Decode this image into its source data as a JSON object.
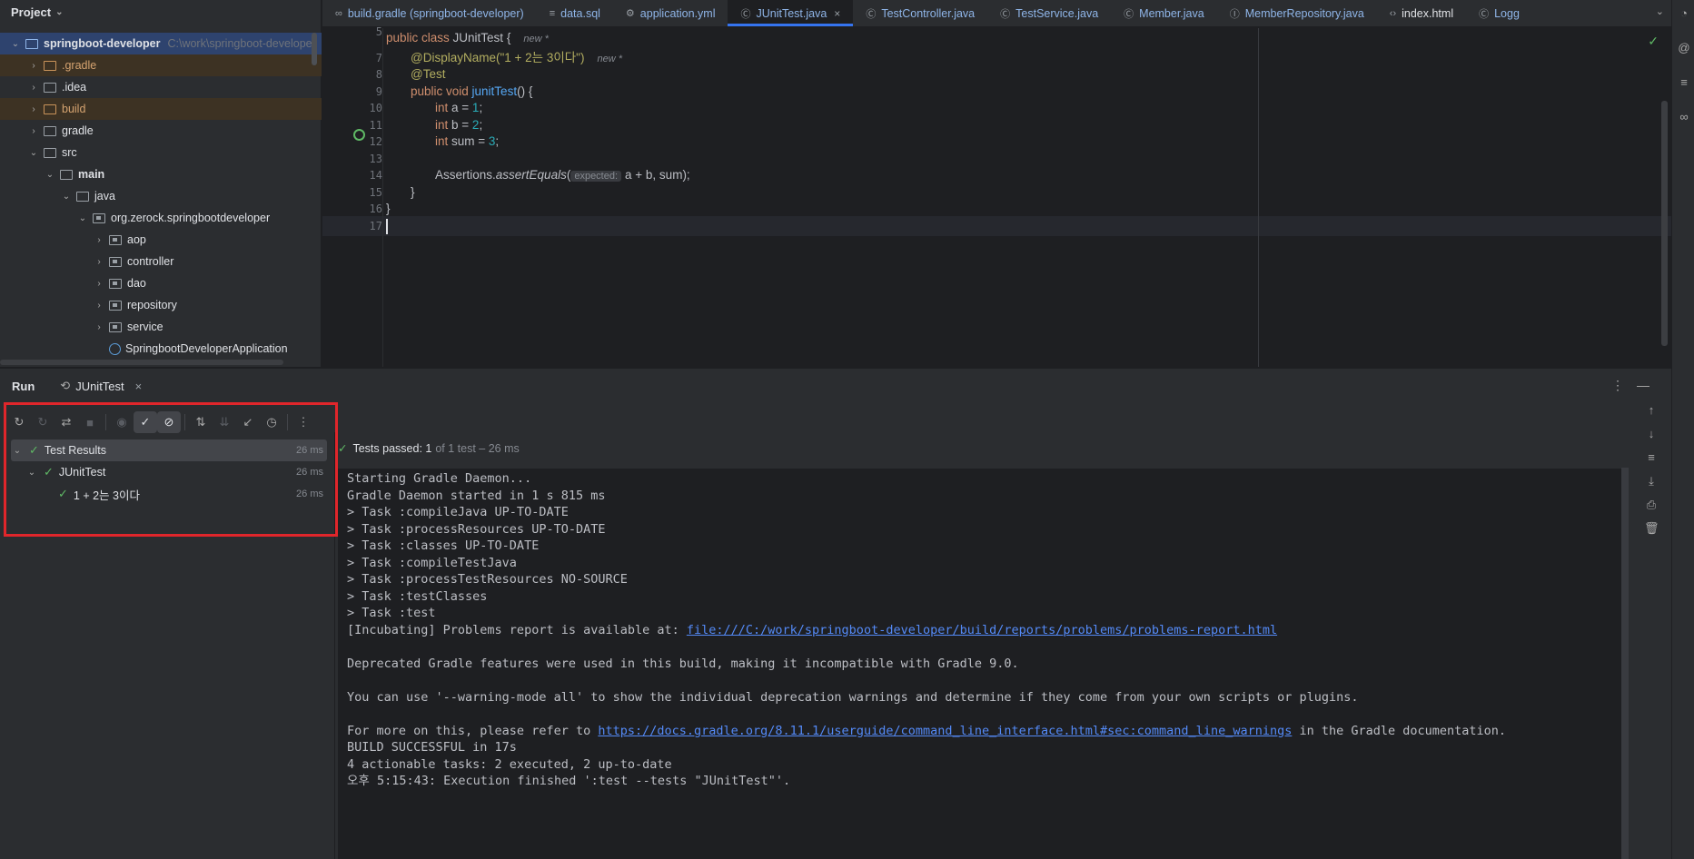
{
  "project": {
    "title": "Project",
    "tree": [
      {
        "label": "springboot-developer",
        "path": "C:\\work\\springboot-developer",
        "arrow": "v",
        "kind": "module"
      },
      {
        "label": ".gradle",
        "arrow": ">",
        "kind": "folder-excluded"
      },
      {
        "label": ".idea",
        "arrow": ">",
        "kind": "folder"
      },
      {
        "label": "build",
        "arrow": ">",
        "kind": "folder-excluded"
      },
      {
        "label": "gradle",
        "arrow": ">",
        "kind": "folder"
      },
      {
        "label": "src",
        "arrow": "v",
        "kind": "folder"
      },
      {
        "label": "main",
        "arrow": "v",
        "kind": "folder"
      },
      {
        "label": "java",
        "arrow": "v",
        "kind": "folder"
      },
      {
        "label": "org.zerock.springbootdeveloper",
        "arrow": "v",
        "kind": "package"
      },
      {
        "label": "aop",
        "arrow": ">",
        "kind": "package"
      },
      {
        "label": "controller",
        "arrow": ">",
        "kind": "package"
      },
      {
        "label": "dao",
        "arrow": ">",
        "kind": "package"
      },
      {
        "label": "repository",
        "arrow": ">",
        "kind": "package"
      },
      {
        "label": "service",
        "arrow": ">",
        "kind": "package"
      },
      {
        "label": "SpringbootDeveloperApplication",
        "arrow": "",
        "kind": "class"
      }
    ]
  },
  "tabs": [
    {
      "label": "build.gradle (springboot-developer)",
      "icon": "gradle-icon"
    },
    {
      "label": "data.sql",
      "icon": "database-icon"
    },
    {
      "label": "application.yml",
      "icon": "yaml-icon"
    },
    {
      "label": "JUnitTest.java",
      "icon": "test-class-icon",
      "active": true
    },
    {
      "label": "TestController.java",
      "icon": "class-icon"
    },
    {
      "label": "TestService.java",
      "icon": "class-icon"
    },
    {
      "label": "Member.java",
      "icon": "class-icon"
    },
    {
      "label": "MemberRepository.java",
      "icon": "interface-icon"
    },
    {
      "label": "index.html",
      "icon": "html-icon"
    },
    {
      "label": "Logg",
      "icon": "class-icon"
    }
  ],
  "editor": {
    "line_numbers": [
      "5",
      "7",
      "8",
      "9",
      "10",
      "11",
      "12",
      "13",
      "14",
      "15",
      "16",
      "17"
    ],
    "hint_new": "new *",
    "inlay_expected": "expected:",
    "code": {
      "l5": "public class JUnitTest {",
      "l7": "@DisplayName(\"1 + 2는 3이다\")",
      "l8": "@Test",
      "l9": "public void junitTest() {",
      "l10": "int a = 1;",
      "l11": "int b = 2;",
      "l12": "int sum = 3;",
      "l14a": "Assertions.assertEquals(",
      "l14b": "a + b, sum);",
      "l15": "}",
      "l16": "}"
    }
  },
  "run": {
    "title": "Run",
    "tab_label": "JUnitTest",
    "results": [
      {
        "label": "Test Results",
        "time": "26 ms"
      },
      {
        "label": "JUnitTest",
        "time": "26 ms"
      },
      {
        "label": "1 + 2는 3이다",
        "time": "26 ms"
      }
    ],
    "status": {
      "main": "Tests passed:",
      "count": "1",
      "sub": "of 1 test – 26 ms"
    },
    "console": [
      "Starting Gradle Daemon...",
      "Gradle Daemon started in 1 s 815 ms",
      "> Task :compileJava UP-TO-DATE",
      "> Task :processResources UP-TO-DATE",
      "> Task :classes UP-TO-DATE",
      "> Task :compileTestJava",
      "> Task :processTestResources NO-SOURCE",
      "> Task :testClasses",
      "> Task :test"
    ],
    "incubating_prefix": "[Incubating] Problems report is available at: ",
    "problems_link": "file:///C:/work/springboot-developer/build/reports/problems/problems-report.html",
    "deprecated_line": "Deprecated Gradle features were used in this build, making it incompatible with Gradle 9.0.",
    "warning_mode_line": "You can use '--warning-mode all' to show the individual deprecation warnings and determine if they come from your own scripts or plugins.",
    "more_info_prefix": "For more on this, please refer to ",
    "docs_link": "https://docs.gradle.org/8.11.1/userguide/command_line_interface.html#sec:command_line_warnings",
    "more_info_suffix": " in the Gradle documentation.",
    "build_successful": "BUILD SUCCESSFUL in 17s",
    "actionable": "4 actionable tasks: 2 executed, 2 up-to-date",
    "finished": "오후 5:15:43: Execution finished ':test --tests \"JUnitTest\"'."
  },
  "colors": {
    "accent": "#3574f0",
    "pass": "#5fb865",
    "highlight": "#e0262b"
  }
}
